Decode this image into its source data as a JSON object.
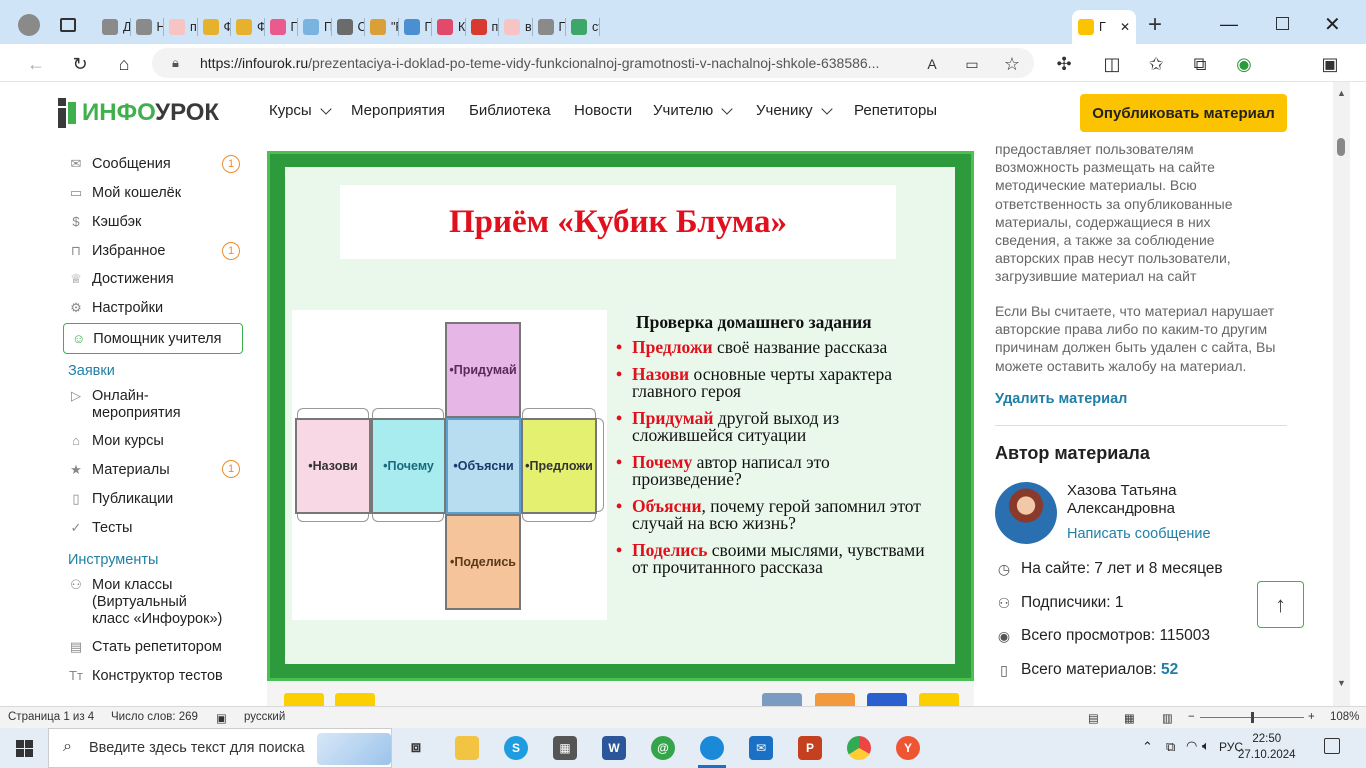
{
  "browser": {
    "tabs": [
      {
        "label": "",
        "icon": "profile-icon"
      },
      {
        "label": "",
        "icon": "tab-actions-icon"
      },
      {
        "label": "Дзен",
        "icon": "plus-icon",
        "color": "#8a8a8a"
      },
      {
        "label": "На по",
        "icon": "plus-icon",
        "color": "#8a8a8a"
      },
      {
        "label": "презе",
        "icon": "yandex-icon",
        "color": "#f7c4c4"
      },
      {
        "label": "Форм",
        "icon": "play-icon",
        "color": "#e6b12d"
      },
      {
        "label": "Форм",
        "icon": "play-icon",
        "color": "#e6b12d"
      },
      {
        "label": "Презе",
        "icon": "flower-icon",
        "color": "#e95a8d"
      },
      {
        "label": "Презе",
        "icon": "multi-icon",
        "color": "#7ab3e0"
      },
      {
        "label": "Слайд",
        "icon": "slides-icon",
        "color": "#6b6b6b"
      },
      {
        "label": "\"Разв",
        "icon": "pen-icon",
        "color": "#d9a038"
      },
      {
        "label": "Презе",
        "icon": "book-icon",
        "color": "#4a8fd2"
      },
      {
        "label": "Катал",
        "icon": "d-icon",
        "color": "#e24a6b"
      },
      {
        "label": "презе",
        "icon": "pdf-icon",
        "color": "#d93a2f"
      },
      {
        "label": "виды",
        "icon": "yandex-icon",
        "color": "#f7c4c4"
      },
      {
        "label": "Презе",
        "icon": "doc-icon",
        "color": "#8a8a8a"
      },
      {
        "label": "статья",
        "icon": "check-icon",
        "color": "#3fa66a"
      },
      {
        "label": "Г",
        "icon": "infourok-icon",
        "color": "#fcc400"
      }
    ],
    "url_host": "https://infourok.ru",
    "url_path": "/prezentaciya-i-doklad-po-teme-vidy-funkcionalnoj-gramotnosti-v-nachalnoj-shkole-638586..."
  },
  "site": {
    "logo_part1": "ИНФО",
    "logo_part2": "УРОК",
    "nav": [
      "Курсы",
      "Мероприятия",
      "Библиотека",
      "Новости",
      "Учителю",
      "Ученику",
      "Репетиторы"
    ],
    "publish_label": "Опубликовать материал"
  },
  "sidebar": {
    "items_top": [
      {
        "label": "Сообщения",
        "icon": "mail-icon",
        "badge": "1"
      },
      {
        "label": "Мой кошелёк",
        "icon": "wallet-icon",
        "badge": ""
      },
      {
        "label": "Кэшбэк",
        "icon": "cashback-icon",
        "badge": ""
      },
      {
        "label": "Избранное",
        "icon": "bookmark-icon",
        "badge": "1"
      },
      {
        "label": "Достижения",
        "icon": "trophy-icon",
        "badge": ""
      },
      {
        "label": "Настройки",
        "icon": "gear-icon",
        "badge": ""
      }
    ],
    "helper_label": "Помощник учителя",
    "section_requests": "Заявки",
    "items_requests": [
      {
        "label": "Онлайн-\nмероприятия",
        "icon": "play-icon",
        "badge": ""
      },
      {
        "label": "Мои курсы",
        "icon": "cap-icon",
        "badge": ""
      },
      {
        "label": "Материалы",
        "icon": "star-icon",
        "badge": "1"
      },
      {
        "label": "Публикации",
        "icon": "book-icon",
        "badge": ""
      },
      {
        "label": "Тесты",
        "icon": "check-circle-icon",
        "badge": ""
      }
    ],
    "section_tools": "Инструменты",
    "items_tools": [
      {
        "label": "Мои классы\n(Виртуальный\nкласс «Инфоурок»)",
        "icon": "group-icon"
      },
      {
        "label": "Стать репетитором",
        "icon": "tutor-icon"
      },
      {
        "label": "Конструктор тестов",
        "icon": "text-icon"
      }
    ]
  },
  "slide": {
    "title": "Приём «Кубик Блума»",
    "faces": {
      "top": "•Придумай",
      "left": "•Назови",
      "center_left": "•Почему",
      "center": "•Объясни",
      "right": "•Предложи",
      "bottom": "•Поделись"
    },
    "text_heading": "Проверка домашнего задания",
    "bullets": [
      {
        "kw": "Предложи",
        "rest": " своё название рассказа"
      },
      {
        "kw": "Назови",
        "rest": " основные черты характера главного героя"
      },
      {
        "kw": "Придумай",
        "rest": " другой выход из сложившейся ситуации"
      },
      {
        "kw": "Почему",
        "rest": " автор написал это произведение?"
      },
      {
        "kw": "Объясни",
        "rest": ", почему герой запомнил этот случай на всю жизнь?"
      },
      {
        "kw": "Поделись",
        "rest": " своими мыслями, чувствами от прочитанного рассказа"
      }
    ]
  },
  "right_panel": {
    "disclaimer_1": "предоставляет пользователям возможность размещать на сайте методические материалы. Всю ответственность за опубликованные материалы, содержащиеся в них сведения, а также за соблюдение авторских прав несут пользователи, загрузившие материал на сайт",
    "disclaimer_2": "Если Вы считаете, что материал нарушает авторские права либо по каким-то другим причинам должен быть удален с сайта, Вы можете оставить жалобу на материал.",
    "delete_label": "Удалить материал",
    "author_heading": "Автор материала",
    "author_name": "Хазова Татьяна Александровна",
    "write_message": "Написать сообщение",
    "on_site": "На сайте: 7 лет и 8 месяцев",
    "subscribers": "Подписчики: 1",
    "views": "Всего просмотров: 115003",
    "materials_label": "Всего материалов: ",
    "materials_count": "52"
  },
  "word_status": {
    "page": "Страница 1 из 4",
    "words": "Число слов: 269",
    "language": "русский",
    "zoom": "108%"
  },
  "taskbar": {
    "search_placeholder": "Введите здесь текст для поиска",
    "lang": "РУС",
    "time": "22:50",
    "date": "27.10.2024"
  },
  "colors": {
    "brand_green": "#3fb04c",
    "publish_yellow": "#fcc400",
    "link_blue": "#1f7fa6",
    "slide_red": "#e0101c"
  }
}
